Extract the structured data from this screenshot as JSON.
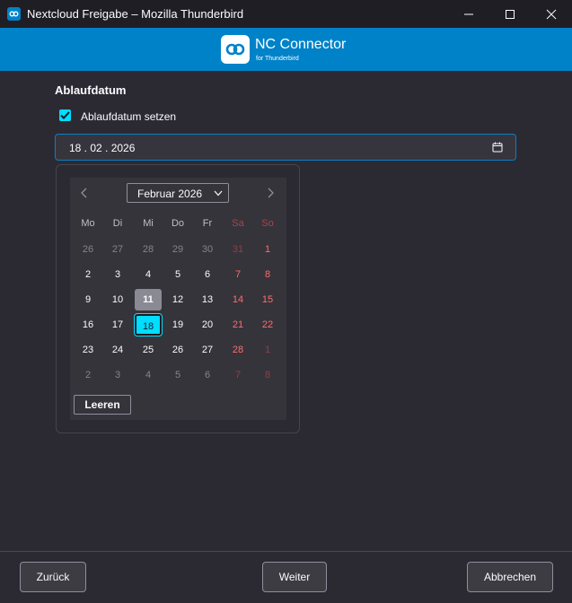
{
  "window": {
    "title": "Nextcloud Freigabe – Mozilla Thunderbird"
  },
  "banner": {
    "brand": "NC Connector",
    "subtitle": "for Thunderbird",
    "color": "#0082c9"
  },
  "section": {
    "heading": "Ablaufdatum"
  },
  "checkbox": {
    "label": "Ablaufdatum setzen",
    "checked": true
  },
  "date_input": {
    "value": "18 . 02 . 2026"
  },
  "calendar": {
    "month_label": "Februar 2026",
    "weekdays": [
      "Mo",
      "Di",
      "Mi",
      "Do",
      "Fr",
      "Sa",
      "So"
    ],
    "weeks": [
      [
        "26",
        "27",
        "28",
        "29",
        "30",
        "31",
        "1"
      ],
      [
        "2",
        "3",
        "4",
        "5",
        "6",
        "7",
        "8"
      ],
      [
        "9",
        "10",
        "11",
        "12",
        "13",
        "14",
        "15"
      ],
      [
        "16",
        "17",
        "18",
        "19",
        "20",
        "21",
        "22"
      ],
      [
        "23",
        "24",
        "25",
        "26",
        "27",
        "28",
        "1"
      ],
      [
        "2",
        "3",
        "4",
        "5",
        "6",
        "7",
        "8"
      ]
    ],
    "today": "11",
    "selected": "18",
    "clear_label": "Leeren"
  },
  "footer": {
    "back_label": "Zurück",
    "next_label": "Weiter",
    "cancel_label": "Abbrechen"
  },
  "icons": {
    "app": "nc-connector-icon",
    "minimize": "minimize-icon",
    "maximize": "maximize-icon",
    "close": "close-icon",
    "calendar": "calendar-icon",
    "prev": "chevron-left-icon",
    "next": "chevron-right-icon",
    "dropdown": "chevron-down-icon",
    "check": "checkmark-icon"
  },
  "colors": {
    "accent": "#00ddff",
    "weekend": "#ff6b6b",
    "background": "#2b2a33"
  }
}
